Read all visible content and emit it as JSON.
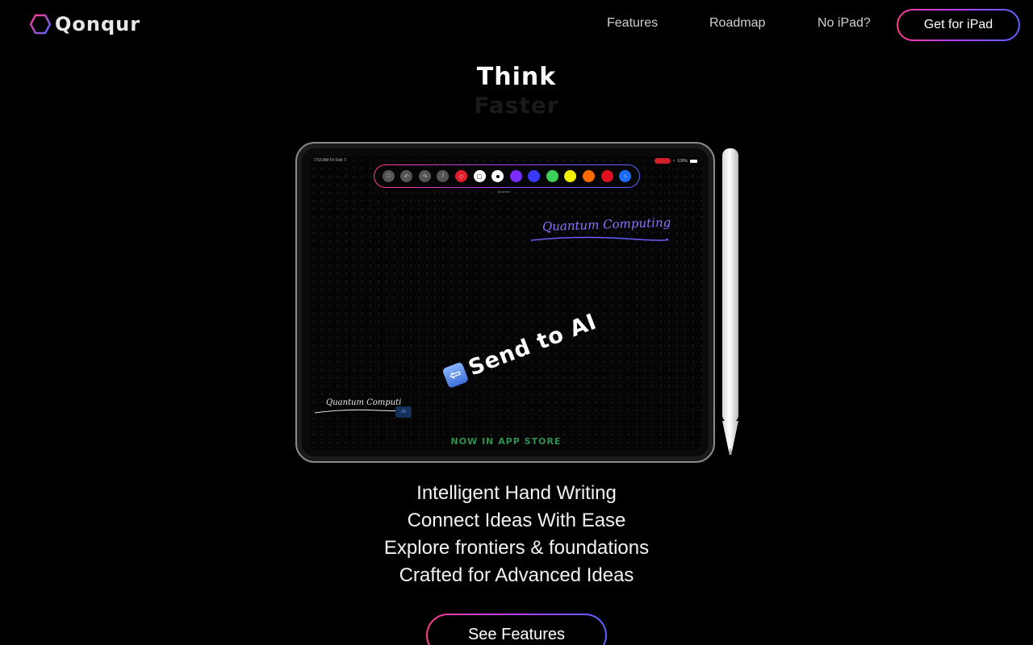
{
  "brand": {
    "name": "Qonqur"
  },
  "nav": {
    "links": [
      "Features",
      "Roadmap",
      "No iPad?"
    ],
    "cta": "Get for iPad"
  },
  "hero": {
    "headline": "Think",
    "subheadline": "Faster"
  },
  "device": {
    "status_time": "7:53 AM   Fri Feb 7",
    "status_battery": "100%",
    "toolbar_label": "Quantum",
    "toolbar_colors": [
      "#ffffff",
      "#7a2cff",
      "#3a3aff",
      "#3ccf5a",
      "#f5f000",
      "#ff6a00",
      "#e0101e",
      "#1a6cff"
    ],
    "handwriting_title": "Quantum Computing",
    "handwriting_small": "Quantum Computing",
    "ai_chip": "AI",
    "send_to_ai": "Send to AI",
    "app_store_text": "NOW IN APP STORE"
  },
  "features": [
    "Intelligent Hand Writing",
    "Connect Ideas With Ease",
    "Explore frontiers & foundations",
    "Crafted for Advanced Ideas"
  ],
  "see_features": "See Features",
  "colors": {
    "accent_gradient": [
      "#ff3c8e",
      "#b040ff",
      "#5a64ff"
    ],
    "background": "#000000",
    "app_store_green": "#2f8f4e"
  }
}
